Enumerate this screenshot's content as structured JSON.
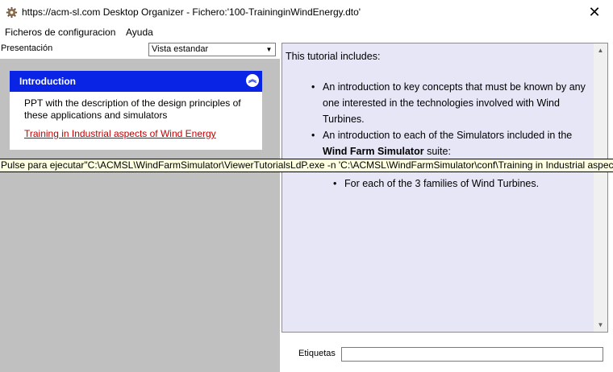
{
  "window": {
    "title": "https://acm-sl.com Desktop Organizer - Fichero:'100-TraininginWindEnergy.dto'",
    "close_glyph": "✕",
    "icon": "gear-app-icon"
  },
  "menu": {
    "items": [
      "Ficheros de configuracion",
      "Ayuda"
    ]
  },
  "presentation": {
    "label": "Presentación",
    "selected": "Vista estandar"
  },
  "panel": {
    "title": "Introduction",
    "description": "PPT with the description of the design principles of these applications and simulators",
    "link": "Training in Industrial aspects of Wind Energy",
    "header_color": "#0a24e6",
    "link_color": "#c00000"
  },
  "content": {
    "intro": "This tutorial includes:",
    "bullets": [
      "An introduction to key concepts that must be known by any one interested in the technologies involved with Wind Turbines.",
      "An introduction to each of the Simulators included in the"
    ],
    "bold_product": "Wind Farm Simulator",
    "suite_suffix": " suite:",
    "sub_bullet": "For each of the 3 families of Wind Turbines."
  },
  "tags": {
    "label": "Etiquetas",
    "value": ""
  },
  "tooltip": {
    "text": "Pulse para ejecutar\"C:\\ACMSL\\WindFarmSimulator\\ViewerTutorialsLdP.exe -n 'C:\\ACMSL\\WindFarmSimulator\\conf\\Training in Industrial aspects"
  }
}
